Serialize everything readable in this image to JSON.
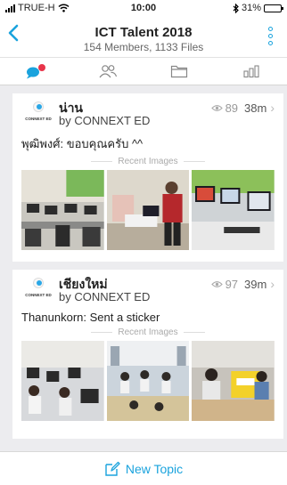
{
  "status_bar": {
    "carrier": "TRUE-H",
    "time": "10:00",
    "battery": "31%",
    "battery_level": 0.31
  },
  "nav": {
    "title": "ICT Talent 2018",
    "subtitle": "154 Members, 1133 Files",
    "back_icon": "chevron-left-icon",
    "more_icon": "vertical-dots-icon"
  },
  "tabs": [
    {
      "icon": "chat-bubbles-icon",
      "active": true
    },
    {
      "icon": "members-icon",
      "active": false
    },
    {
      "icon": "folder-icon",
      "active": false
    },
    {
      "icon": "stats-icon",
      "active": false
    }
  ],
  "topics": [
    {
      "name": "น่าน",
      "author": "by CONNEXT ED",
      "views": "89",
      "time": "38m",
      "last_message": "พุฒิพงศ์: ขอบคุณครับ ^^",
      "recent_label": "Recent Images",
      "logo_text": "CONNEXT ED"
    },
    {
      "name": "เชียงใหม่",
      "author": "by CONNEXT ED",
      "views": "97",
      "time": "39m",
      "last_message": "Thanunkorn: Sent a sticker",
      "recent_label": "Recent Images",
      "logo_text": "CONNEXT ED"
    }
  ],
  "new_topic": {
    "label": "New Topic",
    "icon": "compose-icon"
  },
  "colors": {
    "accent": "#1aa3dd",
    "badge_red": "#e8344a"
  }
}
